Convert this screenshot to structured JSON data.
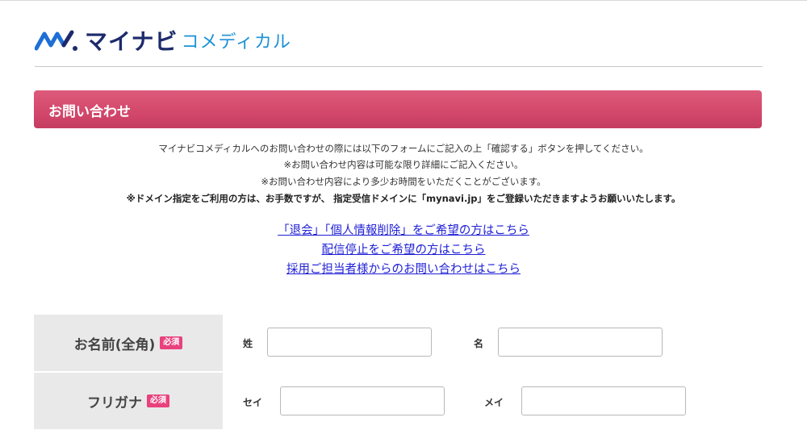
{
  "header": {
    "logo_main": "マイナビ",
    "logo_sub": "コメディカル"
  },
  "banner": {
    "title": "お問い合わせ"
  },
  "intro": {
    "line1": "マイナビコメディカルへのお問い合わせの際には以下のフォームにご記入の上「確認する」ボタンを押してください。",
    "line2": "※お問い合わせ内容は可能な限り詳細にご記入ください。",
    "line3": "※お問い合わせ内容により多少お時間をいただくことがございます。",
    "line4": "※ドメイン指定をご利用の方は、お手数ですが、 指定受信ドメインに「mynavi.jp」をご登録いただきますようお願いいたします。"
  },
  "links": {
    "withdraw": "「退会」「個人情報削除」をご希望の方はこちら",
    "unsubscribe": "配信停止をご希望の方はこちら",
    "recruiter": "採用ご担当者様からのお問い合わせはこちら"
  },
  "form": {
    "name": {
      "label": "お名前(全角)",
      "required": "必須",
      "sei_label": "姓",
      "mei_label": "名",
      "sei_value": "",
      "mei_value": ""
    },
    "kana": {
      "label": "フリガナ",
      "required": "必須",
      "sei_label": "セイ",
      "mei_label": "メイ",
      "sei_value": "",
      "mei_value": ""
    }
  },
  "colors": {
    "banner": "#d2476b",
    "link": "#1f1fd6",
    "required_badge": "#e8417d",
    "logo_navy": "#1d2a6b",
    "logo_blue": "#1d92d6"
  }
}
